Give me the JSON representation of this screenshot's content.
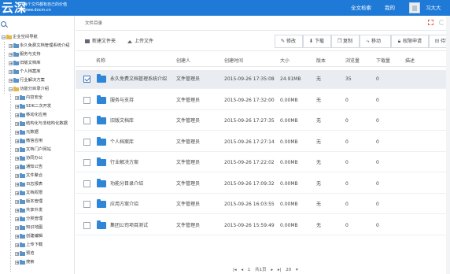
{
  "header": {
    "logo": "云深",
    "tagline": "每个文件都有自己的价值",
    "url": "www.docm.cn",
    "search_label": "全文检索",
    "mine_label": "我的",
    "user_name": "习大大"
  },
  "sidebar": {
    "items": [
      {
        "label": "企业空间导航",
        "toggle": "−",
        "open": true
      },
      {
        "label": "永久免费文档管理系统介绍",
        "toggle": "+"
      },
      {
        "label": "服务与支持",
        "toggle": "+"
      },
      {
        "label": "旧版文档库",
        "toggle": "+"
      },
      {
        "label": "个人档案库",
        "toggle": "+"
      },
      {
        "label": "行业解决方案",
        "toggle": "+"
      },
      {
        "label": "功能分目录介绍",
        "toggle": "−",
        "open": true
      },
      {
        "label": "内容安全",
        "toggle": "+"
      },
      {
        "label": "SDK二次开发",
        "toggle": "+"
      },
      {
        "label": "移动化应用",
        "toggle": "+"
      },
      {
        "label": "结构化与非结构化数据",
        "toggle": "+"
      },
      {
        "label": "元数据",
        "toggle": "+"
      },
      {
        "label": "微信应用",
        "toggle": "+"
      },
      {
        "label": "文档门户网站",
        "toggle": "+"
      },
      {
        "label": "协同办公",
        "toggle": "+"
      },
      {
        "label": "通知公告",
        "toggle": "+"
      },
      {
        "label": "文件聚合",
        "toggle": "+"
      },
      {
        "label": "日志报表",
        "toggle": "+"
      },
      {
        "label": "文档权限",
        "toggle": "+"
      },
      {
        "label": "版本管理",
        "toggle": "+"
      },
      {
        "label": "共享外发",
        "toggle": "+"
      },
      {
        "label": "分类管理",
        "toggle": "+"
      },
      {
        "label": "知识地图",
        "toggle": "+"
      },
      {
        "label": "创建编辑",
        "toggle": "+"
      },
      {
        "label": "上传下载",
        "toggle": "+"
      },
      {
        "label": "预览",
        "toggle": "+"
      },
      {
        "label": "搜索",
        "toggle": "+"
      }
    ]
  },
  "panel": {
    "title": "文件目录"
  },
  "toolbar": {
    "new_folder": "新建文件夹",
    "upload": "上传文件",
    "edit": "修改",
    "download": "下载",
    "copy": "复制",
    "move": "移动",
    "permission": "权限申请",
    "pending": "待审"
  },
  "table": {
    "columns": {
      "name": "名称",
      "creator": "创建人",
      "created": "创建时间",
      "size": "大小",
      "version": "版本",
      "views": "浏览量",
      "downloads": "下载量",
      "desc": "描述"
    },
    "rows": [
      {
        "name": "永久免费文档管理系统介绍",
        "creator": "文件管理员",
        "created": "2015-09-26 17:35:08",
        "size": "24.91MB",
        "version": "无",
        "views": "35",
        "downloads": "0",
        "selected": true
      },
      {
        "name": "服务与支持",
        "creator": "文件管理员",
        "created": "2015-09-26 17:32:00",
        "size": "0.00MB",
        "version": "无",
        "views": "0",
        "downloads": "0"
      },
      {
        "name": "旧版文档库",
        "creator": "文件管理员",
        "created": "2015-09-26 17:27:35",
        "size": "0.00MB",
        "version": "无",
        "views": "0",
        "downloads": "0"
      },
      {
        "name": "个人档案库",
        "creator": "文件管理员",
        "created": "2015-09-26 17:27:14",
        "size": "0.00MB",
        "version": "无",
        "views": "0",
        "downloads": "0"
      },
      {
        "name": "行业解决方案",
        "creator": "文件管理员",
        "created": "2015-09-26 17:22:02",
        "size": "0.00MB",
        "version": "无",
        "views": "0",
        "downloads": "0"
      },
      {
        "name": "功能分目录介绍",
        "creator": "文件管理员",
        "created": "2015-09-26 17:09:32",
        "size": "0.00MB",
        "version": "无",
        "views": "0",
        "downloads": "0"
      },
      {
        "name": "应用方案介绍",
        "creator": "文件管理员",
        "created": "2015-09-26 16:03:55",
        "size": "0.00MB",
        "version": "无",
        "views": "0",
        "downloads": "0"
      },
      {
        "name": "集团公司项目测试",
        "creator": "文件管理员",
        "created": "2015-09-26 15:59:49",
        "size": "0.00MB",
        "version": "无",
        "views": "0",
        "downloads": "0"
      }
    ]
  },
  "pager": {
    "first": "|◂",
    "prev": "◂",
    "page_text": "1",
    "of_text": "共1页",
    "next": "▸",
    "last": "▸|",
    "page_size": "20"
  },
  "colors": {
    "accent": "#1e7ad6",
    "folder": "#2f86d6",
    "selected_row": "#e9edf2"
  }
}
